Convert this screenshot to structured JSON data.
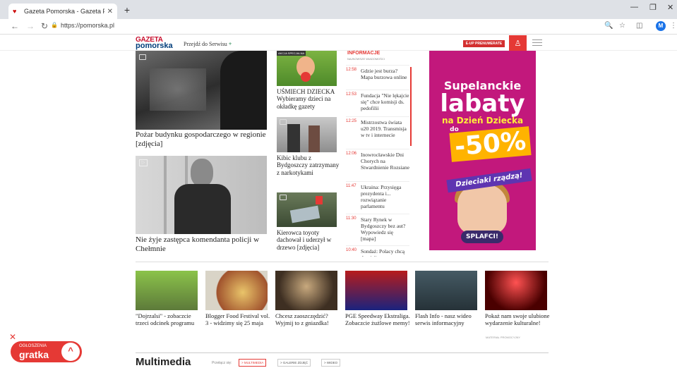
{
  "browser": {
    "tab_title": "Gazeta Pomorska - Gazeta Pomo",
    "url": "https://pomorska.pl",
    "avatar_letter": "M"
  },
  "header": {
    "logo_line1": "GAZETA",
    "logo_line2": "pomorska",
    "przejdz": "Przejdź do Serwisu",
    "plus": "+",
    "prenumerata": "E-UP PRENUMERATE"
  },
  "main": {
    "story1": {
      "caption": "Pożar budynku gospodarczego w regionie [zdjęcia]"
    },
    "story2": {
      "caption": "Nie żyje zastępca komendanta policji w Chełmnie"
    },
    "mid1": {
      "badge": "AKCJA SPECJALNA",
      "caption": "UŚMIECH DZIECKA Wybieramy dzieci na okładkę gazety"
    },
    "mid2": {
      "caption": "Kibic klubu z Bydgoszczy zatrzymany z narkotykami"
    },
    "mid3": {
      "caption": "Kierowca toyoty dachował i uderzył w drzewo [zdjęcia]"
    }
  },
  "feed": {
    "title": "INFORMACJE",
    "subtitle": "NAJNOWSZE WIADOMOŚCI",
    "items": [
      {
        "time": "12:58",
        "text": "Gdzie jest burza? Mapa burzowa online"
      },
      {
        "time": "12:53",
        "text": "Fundacja \"Nie lękajcie się\" chce komisji ds. pedofilii"
      },
      {
        "time": "12:25",
        "text": "Mistrzostwa świata u20 2019. Transmisja w tv i internecie"
      },
      {
        "time": "12:06",
        "text": "Inowrocławskie Dni Chorych na Stwardnienie Rozsiane"
      },
      {
        "time": "11:47",
        "text": "Ukraina: Przysięga prezydenta i... rozwiązanie parlamentu"
      },
      {
        "time": "11:30",
        "text": "Stary Rynek w Bydgoszczy bez aut? Wypowiedz się [mapa]"
      },
      {
        "time": "10:40",
        "text": "Sondaż: Polacy chcą dymisji"
      }
    ]
  },
  "ad": {
    "line1": "Supelanckie",
    "line2": "labaty",
    "line3": "na Dzień Dziecka",
    "line4": "do",
    "percent": "-50%",
    "ribbon": "Dzieciaki rządzą!",
    "button": "SPLAFCI!"
  },
  "bottom": {
    "items": [
      {
        "caption": "\"Dojrzalsi\" - zobaczcie trzeci odcinek programu"
      },
      {
        "caption": "Blogger Food Festival vol. 3 - widzimy się 25 maja"
      },
      {
        "caption": "Chcesz zaoszczędzić? Wyjmij to z gniazdka!"
      },
      {
        "caption": "PGE Speedway Ekstraliga. Zobaczcie żużlowe memy!"
      },
      {
        "caption": "Flash Info - nasz wideo serwis informacyjny"
      },
      {
        "caption": "Pokaż nam swoje ulubione wydarzenie kulturalne!"
      }
    ],
    "partner": "MATERIAŁ PROMOCYJNY"
  },
  "multimedia": {
    "title": "Multimedia",
    "przelacz": "Przełącz się:",
    "tabs": [
      "> MULTIMEDIA",
      "> GALERIE ZDJĘĆ",
      "> WIDEO"
    ]
  },
  "gratka": {
    "ogloszenia": "OGŁOSZENIA",
    "brand": "gratka",
    "close": "✕",
    "up": "^"
  },
  "colors": {
    "accent": "#e53935",
    "brand_blue": "#003d7a",
    "ad_bg": "#c2187c"
  }
}
